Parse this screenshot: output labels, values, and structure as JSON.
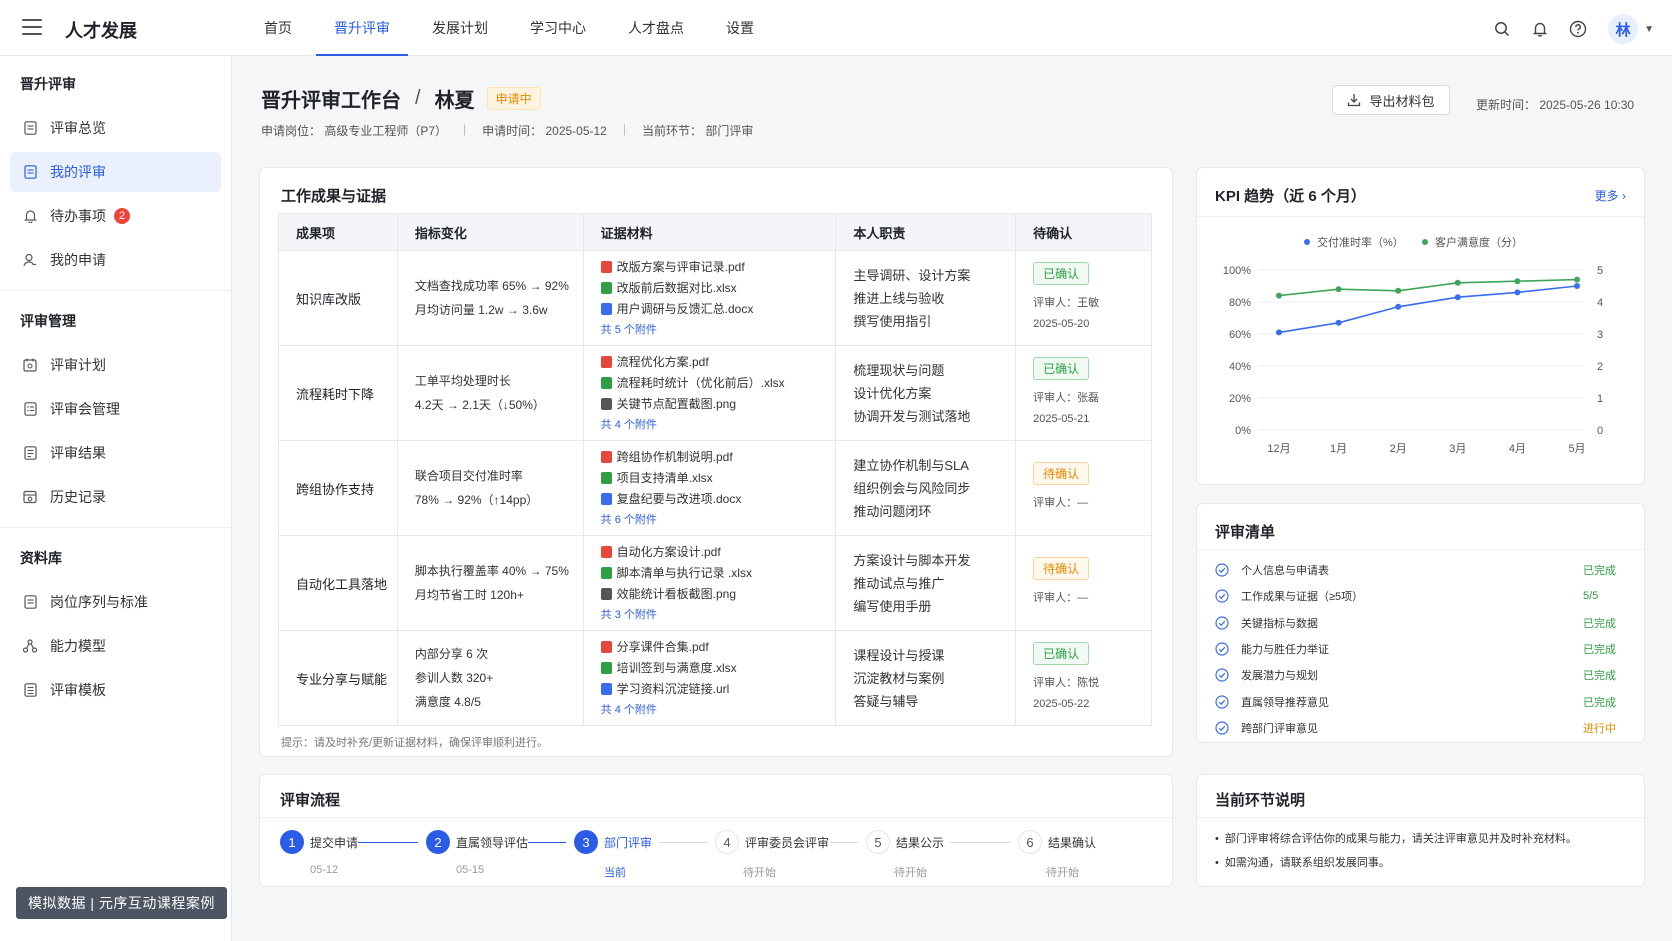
{
  "app": {
    "title": "人才发展"
  },
  "nav": {
    "tabs": [
      {
        "label": "首页",
        "active": false
      },
      {
        "label": "晋升评审",
        "active": true
      },
      {
        "label": "发展计划",
        "active": false
      },
      {
        "label": "学习中心",
        "active": false
      },
      {
        "label": "人才盘点",
        "active": false
      },
      {
        "label": "设置",
        "active": false
      }
    ]
  },
  "user": {
    "avatar_text": "林"
  },
  "sidebar": {
    "group1": "晋升评审",
    "group1_items": [
      {
        "label": "评审总览",
        "icon": "doc-icon"
      },
      {
        "label": "我的评审",
        "icon": "doc-icon",
        "active": true
      },
      {
        "label": "待办事项",
        "icon": "bell-icon",
        "badge": "2"
      },
      {
        "label": "我的申请",
        "icon": "user-icon"
      }
    ],
    "group2": "评审管理",
    "group2_items": [
      {
        "label": "评审计划",
        "icon": "calendar-icon"
      },
      {
        "label": "评审会管理",
        "icon": "list-icon"
      },
      {
        "label": "评审结果",
        "icon": "result-icon"
      },
      {
        "label": "历史记录",
        "icon": "history-icon"
      }
    ],
    "group3": "资料库",
    "group3_items": [
      {
        "label": "岗位序列与标准",
        "icon": "doc-icon"
      },
      {
        "label": "能力模型",
        "icon": "model-icon"
      },
      {
        "label": "评审模板",
        "icon": "doc-icon"
      }
    ],
    "watermark": "模拟数据 | 元序互动课程案例"
  },
  "header": {
    "title": "晋升评审工作台",
    "sep": "/",
    "name": "林夏",
    "status": "申请中",
    "meta": {
      "position": "申请岗位： 高级专业工程师（P7）",
      "apply_time": "申请时间： 2025-05-12",
      "stage": "当前环节： 部门评审"
    },
    "export_label": "导出材料包",
    "updated": "更新时间： 2025-05-26 10:30"
  },
  "evidence": {
    "title": "工作成果与证据",
    "columns": [
      "成果项",
      "指标变化",
      "证据材料",
      "本人职责",
      "待确认"
    ],
    "rows": [
      {
        "name": "知识库改版",
        "metrics": [
          "文档查找成功率 65% → 92%",
          "月均访问量 1.2w → 3.6w"
        ],
        "files": [
          {
            "type": "pdf",
            "name": "改版方案与评审记录.pdf"
          },
          {
            "type": "xlsx",
            "name": "改版前后数据对比.xlsx"
          },
          {
            "type": "docx",
            "name": "用户调研与反馈汇总.docx"
          }
        ],
        "attach": "共 5 个附件",
        "duties": [
          "主导调研、设计方案",
          "推进上线与验收",
          "撰写使用指引"
        ],
        "confirm": "已确认",
        "confirm_state": "done",
        "reviewer": "评审人：王敏",
        "date": "2025-05-20"
      },
      {
        "name": "流程耗时下降",
        "metrics": [
          "工单平均处理时长",
          "4.2天 → 2.1天（↓50%）"
        ],
        "files": [
          {
            "type": "pdf",
            "name": "流程优化方案.pdf"
          },
          {
            "type": "xlsx",
            "name": "流程耗时统计（优化前后）.xlsx"
          },
          {
            "type": "png",
            "name": "关键节点配置截图.png"
          }
        ],
        "attach": "共 4 个附件",
        "duties": [
          "梳理现状与问题",
          "设计优化方案",
          "协调开发与测试落地"
        ],
        "confirm": "已确认",
        "confirm_state": "done",
        "reviewer": "评审人：张磊",
        "date": "2025-05-21"
      },
      {
        "name": "跨组协作支持",
        "metrics": [
          "联合项目交付准时率",
          "78% → 92%（↑14pp）"
        ],
        "files": [
          {
            "type": "pdf",
            "name": "跨组协作机制说明.pdf"
          },
          {
            "type": "xlsx",
            "name": "项目支持清单.xlsx"
          },
          {
            "type": "docx",
            "name": "复盘纪要与改进项.docx"
          }
        ],
        "attach": "共 6 个附件",
        "duties": [
          "建立协作机制与SLA",
          "组织例会与风险同步",
          "推动问题闭环"
        ],
        "confirm": "待确认",
        "confirm_state": "pending",
        "reviewer": "评审人：—",
        "date": ""
      },
      {
        "name": "自动化工具落地",
        "metrics": [
          "脚本执行覆盖率 40% → 75%",
          "月均节省工时 120h+"
        ],
        "files": [
          {
            "type": "pdf",
            "name": "自动化方案设计.pdf"
          },
          {
            "type": "xlsx",
            "name": "脚本清单与执行记录 .xlsx"
          },
          {
            "type": "png",
            "name": "效能统计看板截图.png"
          }
        ],
        "attach": "共 3 个附件",
        "duties": [
          "方案设计与脚本开发",
          "推动试点与推广",
          "编写使用手册"
        ],
        "confirm": "待确认",
        "confirm_state": "pending",
        "reviewer": "评审人：—",
        "date": ""
      },
      {
        "name": "专业分享与赋能",
        "metrics": [
          "内部分享 6 次",
          "参训人数 320+",
          "满意度 4.8/5"
        ],
        "files": [
          {
            "type": "pdf",
            "name": "分享课件合集.pdf"
          },
          {
            "type": "xlsx",
            "name": "培训签到与满意度.xlsx"
          },
          {
            "type": "docx",
            "name": "学习资料沉淀链接.url"
          }
        ],
        "attach": "共 4 个附件",
        "duties": [
          "课程设计与授课",
          "沉淀教材与案例",
          "答疑与辅导"
        ],
        "confirm": "已确认",
        "confirm_state": "done",
        "reviewer": "评审人：陈悦",
        "date": "2025-05-22"
      }
    ],
    "tip": "提示：请及时补充/更新证据材料，确保评审顺利进行。"
  },
  "kpi": {
    "title": "KPI 趋势（近 6 个月）",
    "more": "更多",
    "chart_data": {
      "type": "line",
      "x": [
        "12月",
        "1月",
        "2月",
        "3月",
        "4月",
        "5月"
      ],
      "series": [
        {
          "name": "交付准时率（%）",
          "values": [
            61,
            67,
            77,
            83,
            86,
            90
          ],
          "axis": "left",
          "color": "#3b6cf0"
        },
        {
          "name": "客户满意度（分）",
          "values": [
            4.2,
            4.4,
            4.35,
            4.6,
            4.65,
            4.7
          ],
          "axis": "right",
          "color": "#3fa55a"
        }
      ],
      "ylim_left": [
        0,
        100
      ],
      "yticks_left": [
        "0%",
        "20%",
        "40%",
        "60%",
        "80%",
        "100%"
      ],
      "ylim_right": [
        0,
        5
      ],
      "yticks_right": [
        "0",
        "1",
        "2",
        "3",
        "4",
        "5"
      ],
      "grid": true,
      "legend": "top-center"
    }
  },
  "checklist": {
    "title": "评审清单",
    "items": [
      {
        "label": "个人信息与申请表",
        "status": "已完成",
        "state": "green"
      },
      {
        "label": "工作成果与证据（≥5项）",
        "status": "5/5",
        "state": "green"
      },
      {
        "label": "关键指标与数据",
        "status": "已完成",
        "state": "green"
      },
      {
        "label": "能力与胜任力举证",
        "status": "已完成",
        "state": "green"
      },
      {
        "label": "发展潜力与规划",
        "status": "已完成",
        "state": "green"
      },
      {
        "label": "直属领导推荐意见",
        "status": "已完成",
        "state": "green"
      },
      {
        "label": "跨部门评审意见",
        "status": "进行中",
        "state": "orange"
      }
    ]
  },
  "flow": {
    "title": "评审流程",
    "steps": [
      {
        "num": "1",
        "label": "提交申请",
        "sub": "05-12",
        "state": "done"
      },
      {
        "num": "2",
        "label": "直属领导评估",
        "sub": "05-15",
        "state": "done"
      },
      {
        "num": "3",
        "label": "部门评审",
        "sub": "当前",
        "state": "current"
      },
      {
        "num": "4",
        "label": "评审委员会评审",
        "sub": "待开始",
        "state": "todo"
      },
      {
        "num": "5",
        "label": "结果公示",
        "sub": "待开始",
        "state": "todo"
      },
      {
        "num": "6",
        "label": "结果确认",
        "sub": "待开始",
        "state": "todo"
      }
    ]
  },
  "stage": {
    "title": "当前环节说明",
    "items": [
      "部门评审将综合评估你的成果与能力，请关注评审意见并及时补充材料。",
      "如需沟通，请联系组织发展同事。"
    ]
  }
}
